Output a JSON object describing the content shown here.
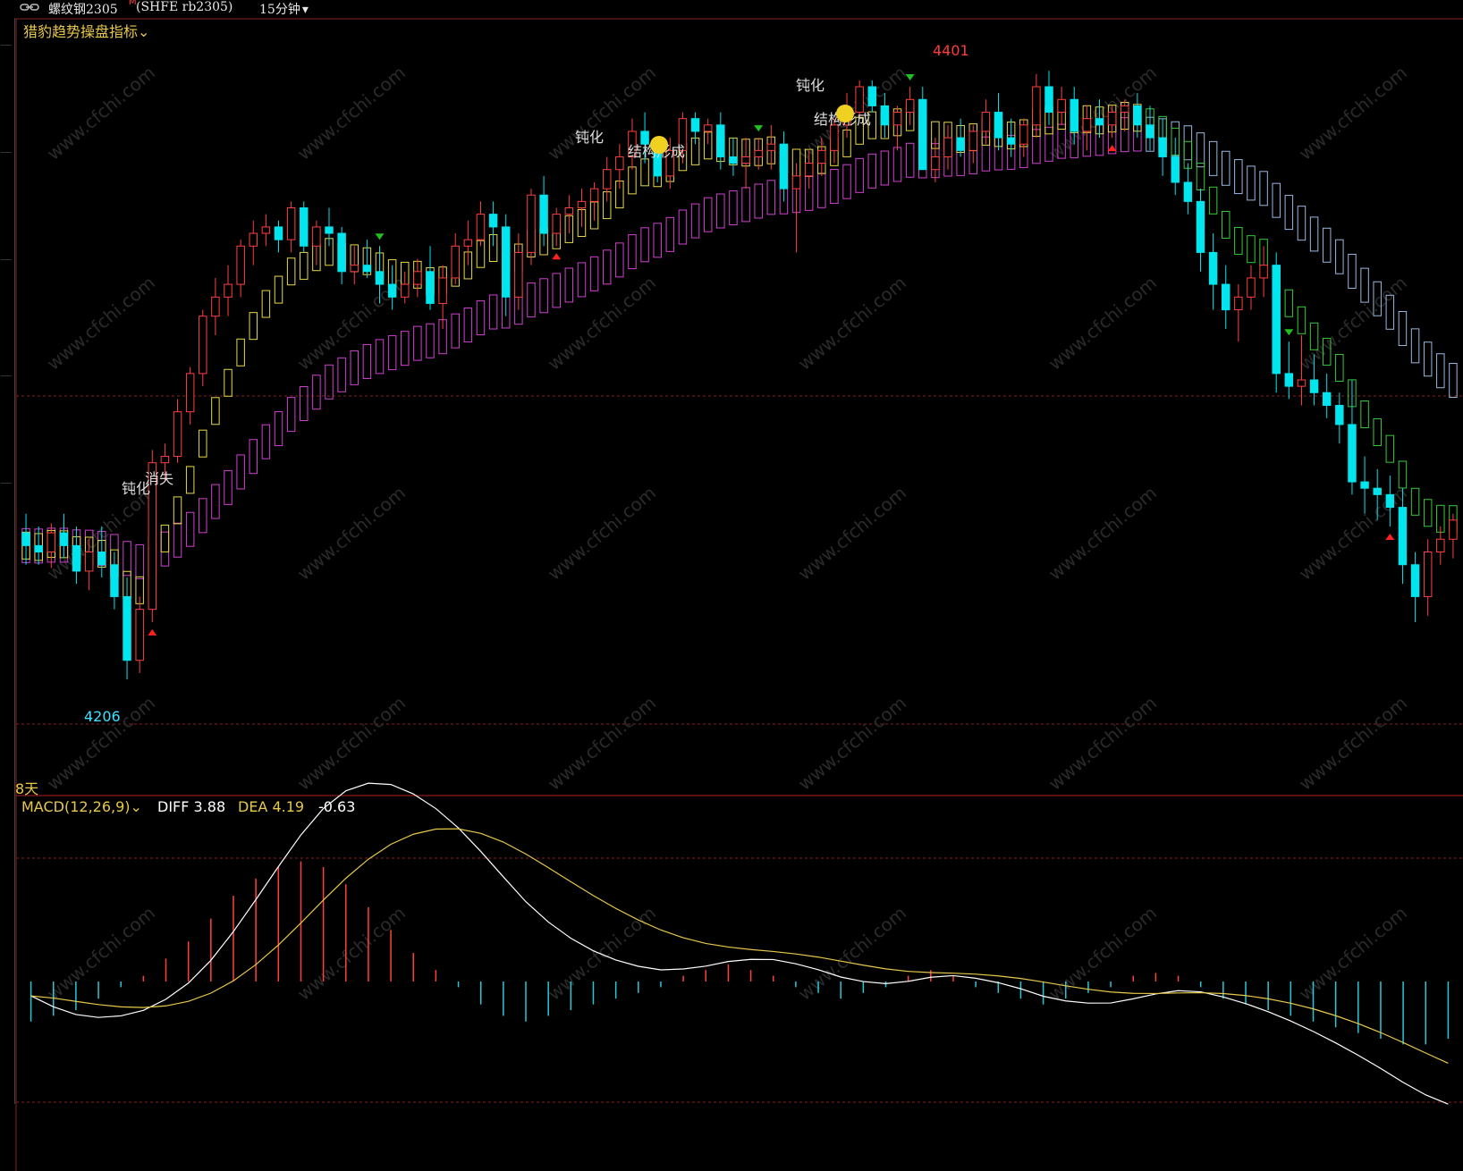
{
  "header": {
    "title": "螺纹钢2305",
    "flag": "M",
    "code": "(SHFE rb2305)",
    "period": "15分钟",
    "period_caret": "▾"
  },
  "indicator": {
    "name": "猎豹趋势操盘指标",
    "caret": "⌄"
  },
  "footer_label": "8天",
  "high_label": "4401",
  "low_label": "4206",
  "signals": [
    {
      "text": "钝化",
      "color": "#39d353"
    },
    {
      "text": "消失",
      "color": "#e6c84a"
    },
    {
      "text": "钝化",
      "color": "#39d353"
    },
    {
      "text": "结构形成",
      "color": "#d040d0"
    },
    {
      "text": "钝化",
      "color": "#39d353"
    },
    {
      "text": "结构形成",
      "color": "#d040d0"
    }
  ],
  "macd": {
    "name": "MACD(12,26,9)",
    "diff": "DIFF 3.88",
    "dea": "DEA 4.19",
    "macd": "-0.63"
  },
  "watermark": "www.cfchi.com",
  "colors": {
    "up": "#ff4040",
    "down": "#00e5ee",
    "ribbon_fast": "#e6d84a",
    "ribbon_slow": "#d040d0",
    "ribbon_bear_fast": "#39c939",
    "ribbon_bear_slow": "#9ab8e0",
    "diff": "#ffffff",
    "dea": "#e6c84a"
  },
  "chart_data": {
    "type": "candlestick",
    "ylim": [
      4196,
      4412
    ],
    "candles": [
      [
        4256,
        4262,
        4246,
        4252
      ],
      [
        4252,
        4258,
        4246,
        4250
      ],
      [
        4250,
        4259,
        4245,
        4256
      ],
      [
        4256,
        4262,
        4248,
        4252
      ],
      [
        4252,
        4258,
        4240,
        4244
      ],
      [
        4244,
        4254,
        4238,
        4250
      ],
      [
        4250,
        4258,
        4242,
        4246
      ],
      [
        4246,
        4250,
        4232,
        4236
      ],
      [
        4236,
        4242,
        4210,
        4216
      ],
      [
        4216,
        4236,
        4212,
        4232
      ],
      [
        4232,
        4282,
        4228,
        4278
      ],
      [
        4278,
        4284,
        4272,
        4280
      ],
      [
        4280,
        4298,
        4278,
        4294
      ],
      [
        4294,
        4308,
        4290,
        4306
      ],
      [
        4306,
        4326,
        4302,
        4324
      ],
      [
        4324,
        4336,
        4318,
        4330
      ],
      [
        4330,
        4340,
        4324,
        4334
      ],
      [
        4334,
        4348,
        4330,
        4346
      ],
      [
        4346,
        4354,
        4340,
        4350
      ],
      [
        4350,
        4356,
        4346,
        4352
      ],
      [
        4352,
        4354,
        4344,
        4348
      ],
      [
        4348,
        4360,
        4344,
        4358
      ],
      [
        4358,
        4360,
        4344,
        4346
      ],
      [
        4346,
        4354,
        4340,
        4352
      ],
      [
        4352,
        4358,
        4346,
        4350
      ],
      [
        4350,
        4352,
        4334,
        4338
      ],
      [
        4338,
        4346,
        4334,
        4340
      ],
      [
        4340,
        4348,
        4336,
        4338
      ],
      [
        4338,
        4346,
        4328,
        4334
      ],
      [
        4334,
        4340,
        4326,
        4330
      ],
      [
        4330,
        4338,
        4328,
        4334
      ],
      [
        4334,
        4342,
        4330,
        4338
      ],
      [
        4338,
        4346,
        4326,
        4328
      ],
      [
        4328,
        4340,
        4320,
        4336
      ],
      [
        4336,
        4350,
        4334,
        4346
      ],
      [
        4346,
        4354,
        4340,
        4348
      ],
      [
        4348,
        4360,
        4346,
        4356
      ],
      [
        4356,
        4360,
        4346,
        4352
      ],
      [
        4352,
        4356,
        4324,
        4330
      ],
      [
        4330,
        4350,
        4326,
        4344
      ],
      [
        4344,
        4364,
        4340,
        4362
      ],
      [
        4362,
        4368,
        4346,
        4350
      ],
      [
        4350,
        4358,
        4346,
        4356
      ],
      [
        4356,
        4362,
        4350,
        4358
      ],
      [
        4358,
        4364,
        4352,
        4360
      ],
      [
        4360,
        4366,
        4354,
        4364
      ],
      [
        4364,
        4374,
        4360,
        4370
      ],
      [
        4370,
        4378,
        4364,
        4374
      ],
      [
        4374,
        4386,
        4370,
        4382
      ],
      [
        4382,
        4388,
        4372,
        4378
      ],
      [
        4378,
        4380,
        4366,
        4368
      ],
      [
        4368,
        4380,
        4364,
        4376
      ],
      [
        4376,
        4388,
        4372,
        4386
      ],
      [
        4386,
        4388,
        4378,
        4382
      ],
      [
        4382,
        4386,
        4378,
        4384
      ],
      [
        4384,
        4388,
        4370,
        4374
      ],
      [
        4374,
        4380,
        4368,
        4372
      ],
      [
        4372,
        4380,
        4364,
        4374
      ],
      [
        4374,
        4380,
        4370,
        4376
      ],
      [
        4376,
        4384,
        4370,
        4378
      ],
      [
        4378,
        4382,
        4360,
        4364
      ],
      [
        4364,
        4372,
        4344,
        4368
      ],
      [
        4368,
        4376,
        4364,
        4372
      ],
      [
        4372,
        4380,
        4368,
        4376
      ],
      [
        4376,
        4386,
        4372,
        4384
      ],
      [
        4384,
        4394,
        4380,
        4388
      ],
      [
        4388,
        4398,
        4386,
        4396
      ],
      [
        4396,
        4398,
        4388,
        4390
      ],
      [
        4390,
        4394,
        4380,
        4384
      ],
      [
        4384,
        4390,
        4376,
        4388
      ],
      [
        4388,
        4396,
        4384,
        4392
      ],
      [
        4392,
        4396,
        4376,
        4370
      ],
      [
        4370,
        4380,
        4366,
        4374
      ],
      [
        4374,
        4384,
        4370,
        4380
      ],
      [
        4380,
        4386,
        4374,
        4376
      ],
      [
        4376,
        4384,
        4372,
        4382
      ],
      [
        4382,
        4392,
        4378,
        4388
      ],
      [
        4388,
        4394,
        4376,
        4380
      ],
      [
        4380,
        4386,
        4374,
        4378
      ],
      [
        4378,
        4386,
        4374,
        4384
      ],
      [
        4384,
        4400,
        4380,
        4396
      ],
      [
        4396,
        4401,
        4384,
        4388
      ],
      [
        4388,
        4396,
        4384,
        4392
      ],
      [
        4392,
        4396,
        4378,
        4382
      ],
      [
        4382,
        4390,
        4376,
        4386
      ],
      [
        4386,
        4392,
        4380,
        4384
      ],
      [
        4384,
        4390,
        4380,
        4388
      ],
      [
        4388,
        4392,
        4382,
        4390
      ],
      [
        4390,
        4394,
        4380,
        4384
      ],
      [
        4384,
        4390,
        4376,
        4380
      ],
      [
        4380,
        4386,
        4368,
        4374
      ],
      [
        4374,
        4380,
        4362,
        4366
      ],
      [
        4366,
        4372,
        4356,
        4360
      ],
      [
        4360,
        4364,
        4338,
        4344
      ],
      [
        4344,
        4350,
        4326,
        4334
      ],
      [
        4334,
        4340,
        4320,
        4326
      ],
      [
        4326,
        4334,
        4316,
        4330
      ],
      [
        4330,
        4340,
        4326,
        4336
      ],
      [
        4336,
        4346,
        4330,
        4340
      ],
      [
        4340,
        4344,
        4300,
        4306
      ],
      [
        4306,
        4316,
        4298,
        4302
      ],
      [
        4302,
        4318,
        4296,
        4304
      ],
      [
        4304,
        4312,
        4296,
        4300
      ],
      [
        4300,
        4306,
        4292,
        4296
      ],
      [
        4296,
        4300,
        4284,
        4290
      ],
      [
        4290,
        4304,
        4268,
        4272
      ],
      [
        4272,
        4280,
        4262,
        4270
      ],
      [
        4270,
        4276,
        4260,
        4268
      ],
      [
        4268,
        4274,
        4258,
        4264
      ],
      [
        4264,
        4270,
        4240,
        4246
      ],
      [
        4246,
        4250,
        4228,
        4236
      ],
      [
        4236,
        4254,
        4230,
        4250
      ],
      [
        4250,
        4258,
        4246,
        4254
      ],
      [
        4254,
        4262,
        4248,
        4260
      ]
    ],
    "macd_hist": [
      -14,
      -12,
      -10,
      -6,
      -2,
      2,
      8,
      14,
      22,
      30,
      36,
      40,
      42,
      40,
      34,
      26,
      18,
      10,
      4,
      -2,
      -8,
      -12,
      -14,
      -12,
      -10,
      -8,
      -6,
      -4,
      -2,
      2,
      4,
      6,
      4,
      2,
      -2,
      -4,
      -6,
      -4,
      -2,
      2,
      4,
      2,
      -2,
      -4,
      -6,
      -8,
      -6,
      -4,
      -2,
      2,
      3,
      2,
      -2,
      -6,
      -8,
      -10,
      -12,
      -14,
      -16,
      -18,
      -20,
      -22,
      -22,
      -20
    ]
  }
}
